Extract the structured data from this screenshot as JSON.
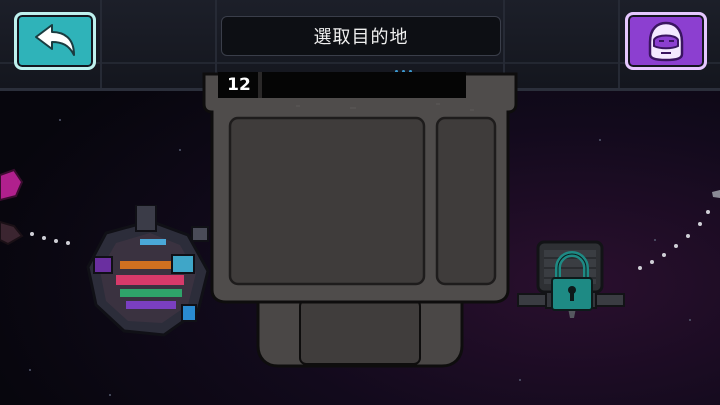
{
  "header": {
    "title": "選取目的地"
  },
  "panel": {
    "count": "12"
  },
  "colors": {
    "back_button": "#2fb3b9",
    "profile_button": "#8c3fd0",
    "lock": "#1e8a84"
  },
  "icons": {
    "back": "back-arrow-icon",
    "profile": "crewmate-face-icon",
    "locked": "padlock-icon"
  }
}
